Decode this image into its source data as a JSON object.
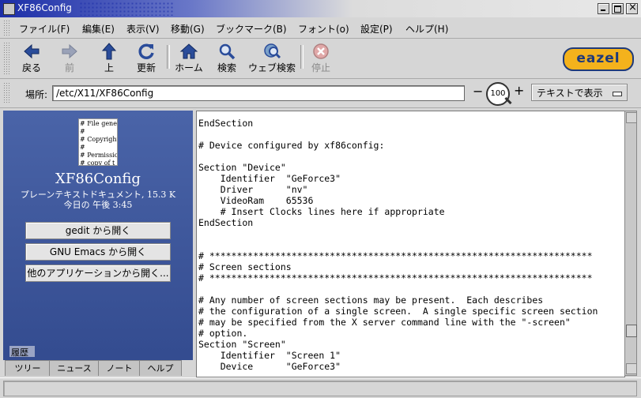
{
  "window": {
    "title": "XF86Config"
  },
  "menubar": {
    "items": [
      "ファイル(F)",
      "編集(E)",
      "表示(V)",
      "移動(G)",
      "ブックマーク(B)",
      "フォント(o)",
      "設定(P)",
      "ヘルプ(H)"
    ]
  },
  "toolbar": {
    "back": "戻る",
    "forward": "前",
    "up": "上",
    "reload": "更新",
    "home": "ホーム",
    "search": "検索",
    "web_search": "ウェブ検索",
    "stop": "停止",
    "logo": "eazel"
  },
  "location": {
    "label": "場所:",
    "value": "/etc/X11/XF86Config",
    "zoom": "100",
    "view_as": "テキストで表示"
  },
  "sidebar": {
    "thumb_lines": [
      "# File gene",
      "#",
      "# Copyright",
      "#",
      "# Permissio",
      "# copy of t"
    ],
    "file_name": "XF86Config",
    "file_type": "プレーンテキストドキュメント, 15.3 K",
    "modified": "今日の 午後 3:45",
    "buttons": [
      "gedit から開く",
      "GNU Emacs から開く",
      "他のアプリケーションから開く..."
    ],
    "history_label": "履歴",
    "tabs": [
      "ツリー",
      "ニュース",
      "ノート",
      "ヘルプ"
    ]
  },
  "content": {
    "text": "EndSection\n\n# Device configured by xf86config:\n\nSection \"Device\"\n    Identifier  \"GeForce3\"\n    Driver      \"nv\"\n    VideoRam    65536\n    # Insert Clocks lines here if appropriate\nEndSection\n\n\n# **********************************************************************\n# Screen sections\n# **********************************************************************\n\n# Any number of screen sections may be present.  Each describes\n# the configuration of a single screen.  A single specific screen section\n# may be specified from the X server command line with the \"-screen\"\n# option.\nSection \"Screen\"\n    Identifier  \"Screen 1\"\n    Device      \"GeForce3\""
  }
}
